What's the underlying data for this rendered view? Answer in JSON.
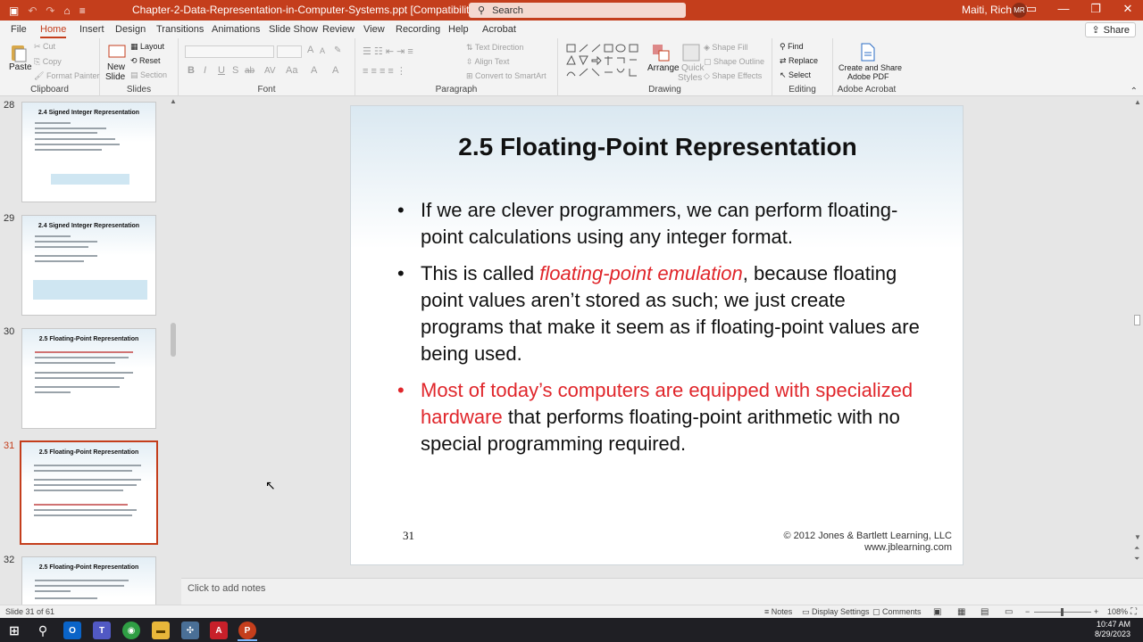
{
  "titlebar": {
    "doc_title": "Chapter-2-Data-Representation-in-Computer-Systems.ppt [Compatibility Mode]  -  PowerPoint",
    "search_placeholder": "Search",
    "user_name": "Maiti, Richard",
    "user_initials": "MR"
  },
  "tabs": [
    {
      "label": "File",
      "active": false
    },
    {
      "label": "Home",
      "active": true
    },
    {
      "label": "Insert",
      "active": false
    },
    {
      "label": "Design",
      "active": false
    },
    {
      "label": "Transitions",
      "active": false
    },
    {
      "label": "Animations",
      "active": false
    },
    {
      "label": "Slide Show",
      "active": false
    },
    {
      "label": "Review",
      "active": false
    },
    {
      "label": "View",
      "active": false
    },
    {
      "label": "Recording",
      "active": false
    },
    {
      "label": "Help",
      "active": false
    },
    {
      "label": "Acrobat",
      "active": false
    }
  ],
  "share_label": "Share",
  "ribbon": {
    "clipboard": {
      "label": "Clipboard",
      "paste": "Paste",
      "cut": "Cut",
      "copy": "Copy",
      "format_painter": "Format Painter"
    },
    "slides": {
      "label": "Slides",
      "new_slide_1": "New",
      "new_slide_2": "Slide",
      "layout": "Layout",
      "reset": "Reset",
      "section": "Section"
    },
    "font": {
      "label": "Font",
      "bold": "B",
      "italic": "I",
      "underline": "U",
      "shadow": "S",
      "strike": "ab",
      "spacing": "AV",
      "case": "Aa",
      "highlight": "A",
      "color": "A",
      "grow": "A",
      "shrink": "A"
    },
    "paragraph": {
      "label": "Paragraph",
      "text_direction": "Text Direction",
      "align_text": "Align Text",
      "convert_smartart": "Convert to SmartArt"
    },
    "drawing": {
      "label": "Drawing",
      "arrange": "Arrange",
      "quick_styles_1": "Quick",
      "quick_styles_2": "Styles",
      "shape_fill": "Shape Fill",
      "shape_outline": "Shape Outline",
      "shape_effects": "Shape Effects"
    },
    "editing": {
      "label": "Editing",
      "find": "Find",
      "replace": "Replace",
      "select": "Select"
    },
    "acrobat": {
      "label": "Adobe Acrobat",
      "create_1": "Create and Share",
      "create_2": "Adobe PDF"
    }
  },
  "thumbnails": [
    {
      "num": "28",
      "title": "2.4 Signed Integer Representation",
      "selected": false
    },
    {
      "num": "29",
      "title": "2.4 Signed Integer Representation",
      "selected": false
    },
    {
      "num": "30",
      "title": "2.5 Floating-Point Representation",
      "selected": false
    },
    {
      "num": "31",
      "title": "2.5 Floating-Point Representation",
      "selected": true
    },
    {
      "num": "32",
      "title": "2.5 Floating-Point Representation",
      "selected": false
    }
  ],
  "slide": {
    "title": "2.5 Floating-Point Representation",
    "b1": "If we are clever programmers, we can perform floating-point calculations using any integer format.",
    "b2_pre": "This is called ",
    "b2_em": "floating-point emulation",
    "b2_post": ", because floating point values aren’t stored as such; we just create programs that make it seem as if floating-point values are being used.",
    "b3_red": "Most of today’s computers are equipped with specialized hardware",
    "b3_post": " that performs floating-point arithmetic with no special programming required.",
    "number": "31",
    "copyright_1": "© 2012 Jones & Bartlett Learning, LLC",
    "copyright_2": "www.jblearning.com"
  },
  "notes_placeholder": "Click to add notes",
  "status": {
    "slide_info": "Slide 31 of 61",
    "notes": "Notes",
    "display_settings": "Display Settings",
    "comments": "Comments",
    "zoom": "108%"
  },
  "taskbar": {
    "time": "10:47 AM",
    "date": "8/29/2023"
  },
  "colors": {
    "accent": "#c43e1c",
    "slide_red": "#e0262b"
  }
}
